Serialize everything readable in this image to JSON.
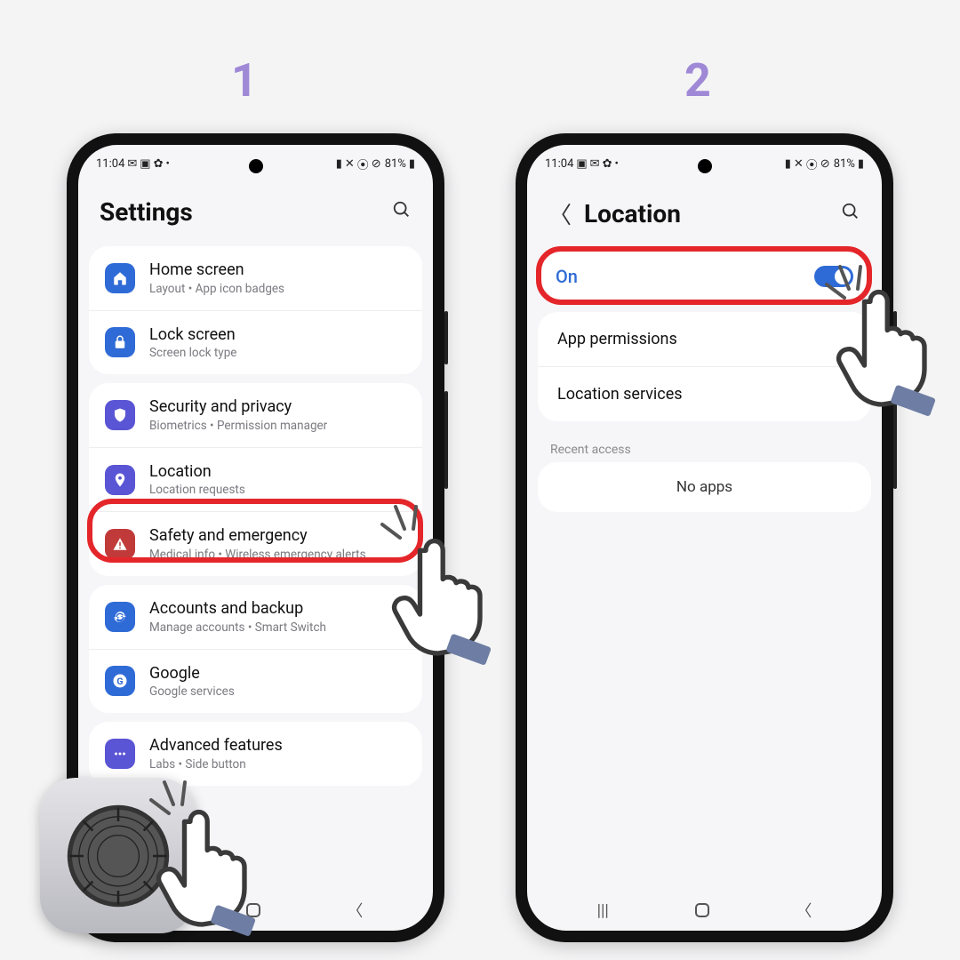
{
  "steps": {
    "one": "1",
    "two": "2"
  },
  "status": {
    "time": "11:04",
    "battery": "81%"
  },
  "screen1": {
    "title": "Settings",
    "groups": [
      [
        {
          "icon": "home",
          "color": "#2f6bd6",
          "title": "Home screen",
          "sub": "Layout  •  App icon badges"
        },
        {
          "icon": "lock",
          "color": "#2f6bd6",
          "title": "Lock screen",
          "sub": "Screen lock type"
        }
      ],
      [
        {
          "icon": "shield",
          "color": "#5a55d4",
          "title": "Security and privacy",
          "sub": "Biometrics  •  Permission manager"
        },
        {
          "icon": "pin",
          "color": "#5a55d4",
          "title": "Location",
          "sub": "Location requests"
        },
        {
          "icon": "alert",
          "color": "#c03a3a",
          "title": "Safety and emergency",
          "sub": "Medical info  •  Wireless emergency alerts"
        }
      ],
      [
        {
          "icon": "sync",
          "color": "#2f6bd6",
          "title": "Accounts and backup",
          "sub": "Manage accounts  •  Smart Switch"
        },
        {
          "icon": "g",
          "color": "#2f6bd6",
          "title": "Google",
          "sub": "Google services"
        }
      ],
      [
        {
          "icon": "dots",
          "color": "#5a55d4",
          "title": "Advanced features",
          "sub": "Labs  •  Side button"
        }
      ]
    ]
  },
  "screen2": {
    "title": "Location",
    "toggle_label": "On",
    "rows": [
      "App permissions",
      "Location services"
    ],
    "section": "Recent access",
    "noapps": "No apps"
  }
}
